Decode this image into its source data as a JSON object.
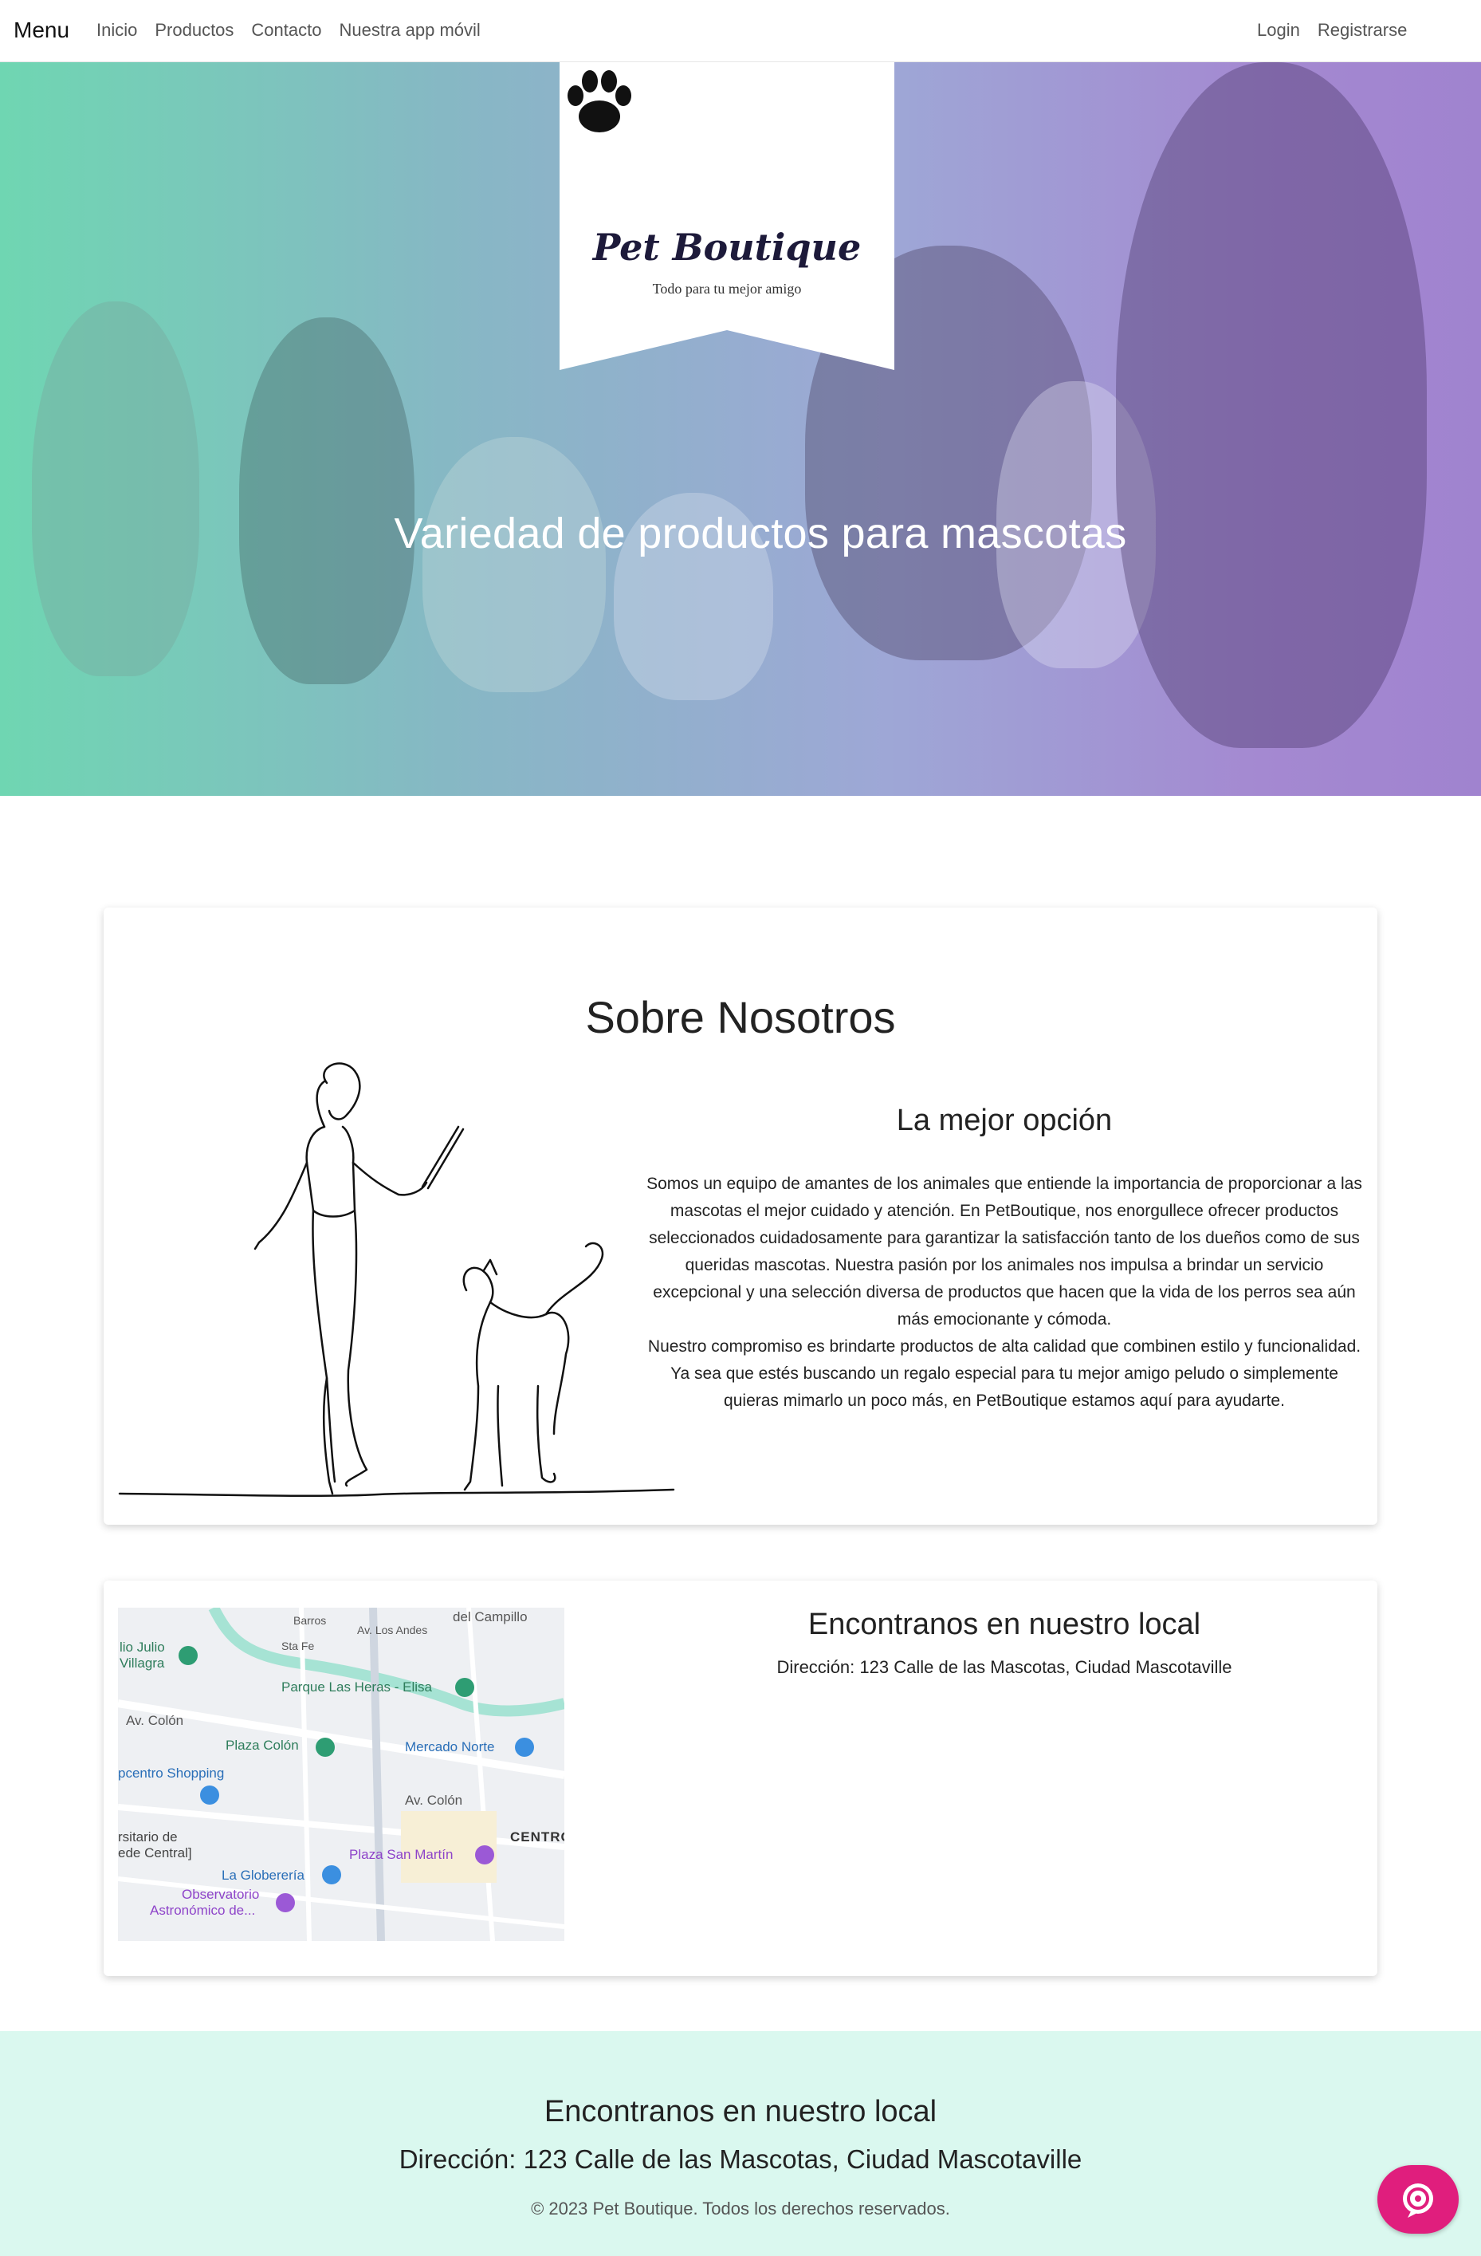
{
  "navbar": {
    "brand": "Menu",
    "links": [
      "Inicio",
      "Productos",
      "Contacto",
      "Nuestra app móvil"
    ],
    "right_links": [
      "Login",
      "Registrarse"
    ]
  },
  "logo": {
    "name": "Pet Boutique",
    "tagline": "Todo para tu mejor amigo"
  },
  "hero": {
    "heading": "Variedad de productos para mascotas"
  },
  "about": {
    "title": "Sobre Nosotros",
    "subtitle": "La mejor opción",
    "paragraph1": "Somos un equipo de amantes de los animales que entiende la importancia de proporcionar a las mascotas el mejor cuidado y atención. En PetBoutique, nos enorgullece ofrecer productos seleccionados cuidadosamente para garantizar la satisfacción tanto de los dueños como de sus queridas mascotas. Nuestra pasión por los animales nos impulsa a brindar un servicio excepcional y una selección diversa de productos que hacen que la vida de los perros sea aún más emocionante y cómoda.",
    "paragraph2": "Nuestro compromiso es brindarte productos de alta calidad que combinen estilo y funcionalidad. Ya sea que estés buscando un regalo especial para tu mejor amigo peludo o simplemente quieras mimarlo un poco más, en PetBoutique estamos aquí para ayudarte."
  },
  "location": {
    "title": "Encontranos en nuestro local",
    "address": "Dirección: 123 Calle de las Mascotas, Ciudad Mascotaville",
    "map_labels": [
      "lio Julio",
      "Villagra",
      "Parque Las Heras - Elisa",
      "Av. Colón",
      "Plaza Colón",
      "Mercado Norte",
      "pcentro Shopping",
      "Av. Colón",
      "rsitario de",
      "ede Central]",
      "La Globerería",
      "Plaza San Martín",
      "CENTRO",
      "Observatorio",
      "Astronómico de...",
      "del Campillo",
      "Sta Fe",
      "Barros",
      "Av. Los Andes"
    ]
  },
  "footer": {
    "title": "Encontranos en nuestro local",
    "address": "Dirección: 123 Calle de las Mascotas, Ciudad Mascotaville",
    "copyright": "© 2023 Pet Boutique. Todos los derechos reservados."
  },
  "colors": {
    "hero_gradient_start": "#6fd6b2",
    "hero_gradient_end": "#a083cf",
    "footer_bg": "#daf8ef",
    "chat_button": "#e01e7d"
  },
  "icons": {
    "logo": "paw-icon",
    "chat": "chat-bubble-icon"
  }
}
